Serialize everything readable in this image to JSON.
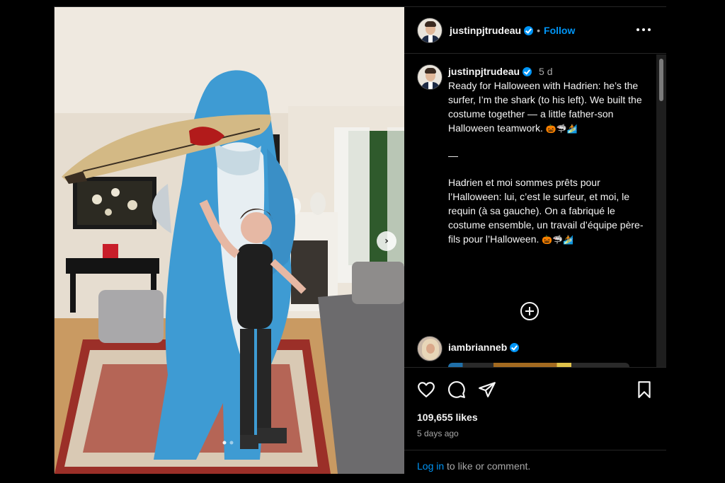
{
  "header": {
    "username": "justinpjtrudeau",
    "separator": "•",
    "follow_label": "Follow",
    "icons": [
      "verified-badge-icon",
      "more-options-icon"
    ]
  },
  "caption": {
    "username": "justinpjtrudeau",
    "age": "5 d",
    "text_en": "Ready for Halloween with Hadrien: he’s the surfer, I’m the shark (to his left). We built the costume together — a little father-son Halloween teamwork.",
    "divider": "—",
    "text_fr": "Hadrien et moi sommes prêts pour l’Halloween: lui, c’est le surfeur, et moi, le requin (à sa gauche). On a fabriqué le costume ensemble, un travail d’équipe père-fils pour l’Halloween.",
    "emojis": [
      "🎃",
      "🦈",
      "🏄"
    ]
  },
  "comment": {
    "username": "iambrianneb"
  },
  "actions": {
    "icons": [
      "heart-icon",
      "comment-icon",
      "share-icon",
      "bookmark-icon",
      "add-comment-icon",
      "next-arrow-icon"
    ],
    "likes": "109,655 likes",
    "time": "5 days ago",
    "login_link": "Log in",
    "login_rest": " to like or comment."
  },
  "colors": {
    "accent": "#0095f6",
    "background": "#000000",
    "secondary_text": "#a8a8a8"
  }
}
